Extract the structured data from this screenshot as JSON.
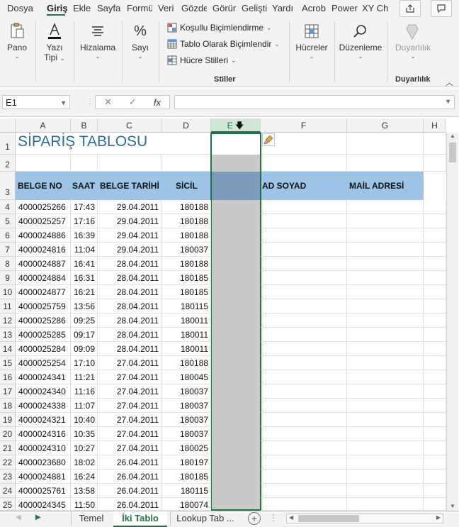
{
  "menu": {
    "tabs": [
      "Dosya",
      "Giriş",
      "Ekle",
      "Sayfa",
      "Formü",
      "Veri",
      "Gözde",
      "Görür",
      "Gelişti",
      "Yardı",
      "Acrob",
      "Power",
      "XY Ch"
    ],
    "active": "Giriş"
  },
  "ribbon": {
    "paste": "Pano",
    "font": "Yazı",
    "font2": "Tipi",
    "alignment": "Hizalama",
    "number": "Sayı",
    "cond_format": "Koşullu Biçimlendirme",
    "table_format": "Tablo Olarak Biçimlendir",
    "cell_styles": "Hücre Stilleri",
    "styles_group": "Stiller",
    "cells": "Hücreler",
    "editing": "Düzenleme",
    "sensitivity": "Duyarlılık",
    "sensitivity_group": "Duyarlılık"
  },
  "formula_bar": {
    "name_box": "E1",
    "formula": ""
  },
  "columns": [
    "A",
    "B",
    "C",
    "D",
    "E",
    "F",
    "G",
    "H"
  ],
  "sheet": {
    "title": "SİPARİŞ TABLOSU",
    "headers": {
      "a": "BELGE NO",
      "b": "SAAT",
      "c": "BELGE TARİHİ",
      "d": "SİCİL",
      "f": "AD SOYAD",
      "g": "MAİL ADRESİ"
    },
    "row_numbers": [
      "1",
      "2",
      "3",
      "4",
      "5",
      "6",
      "7",
      "8",
      "9",
      "10",
      "11",
      "12",
      "13",
      "14",
      "15",
      "16",
      "17",
      "18",
      "19",
      "20",
      "21",
      "22",
      "23",
      "24",
      "25"
    ],
    "rows": [
      [
        "4000025266",
        "17:43",
        "29.04.2011",
        "180188"
      ],
      [
        "4000025257",
        "17:16",
        "29.04.2011",
        "180188"
      ],
      [
        "4000024886",
        "16:39",
        "29.04.2011",
        "180188"
      ],
      [
        "4000024816",
        "11:04",
        "29.04.2011",
        "180037"
      ],
      [
        "4000024887",
        "16:41",
        "28.04.2011",
        "180188"
      ],
      [
        "4000024884",
        "16:31",
        "28.04.2011",
        "180185"
      ],
      [
        "4000024877",
        "16:21",
        "28.04.2011",
        "180185"
      ],
      [
        "4000025759",
        "13:56",
        "28.04.2011",
        "180115"
      ],
      [
        "4000025286",
        "09:25",
        "28.04.2011",
        "180011"
      ],
      [
        "4000025285",
        "09:17",
        "28.04.2011",
        "180011"
      ],
      [
        "4000025284",
        "09:09",
        "28.04.2011",
        "180011"
      ],
      [
        "4000025254",
        "17:10",
        "27.04.2011",
        "180188"
      ],
      [
        "4000024341",
        "11:21",
        "27.04.2011",
        "180045"
      ],
      [
        "4000024340",
        "11:16",
        "27.04.2011",
        "180037"
      ],
      [
        "4000024338",
        "11:07",
        "27.04.2011",
        "180037"
      ],
      [
        "4000024321",
        "10:40",
        "27.04.2011",
        "180037"
      ],
      [
        "4000024316",
        "10:35",
        "27.04.2011",
        "180037"
      ],
      [
        "4000024310",
        "10:27",
        "27.04.2011",
        "180025"
      ],
      [
        "4000023680",
        "18:02",
        "26.04.2011",
        "180197"
      ],
      [
        "4000024881",
        "16:24",
        "26.04.2011",
        "180185"
      ],
      [
        "4000025761",
        "13:58",
        "26.04.2011",
        "180115"
      ],
      [
        "4000024345",
        "11:50",
        "26.04.2011",
        "180074"
      ]
    ]
  },
  "sheet_tabs": [
    "Temel",
    "İki Tablo",
    "Lookup Tab ..."
  ],
  "active_sheet": "İki Tablo",
  "colors": {
    "accent": "#217346",
    "header_fill": "#9dc3e6",
    "title": "#2e6ba1"
  }
}
